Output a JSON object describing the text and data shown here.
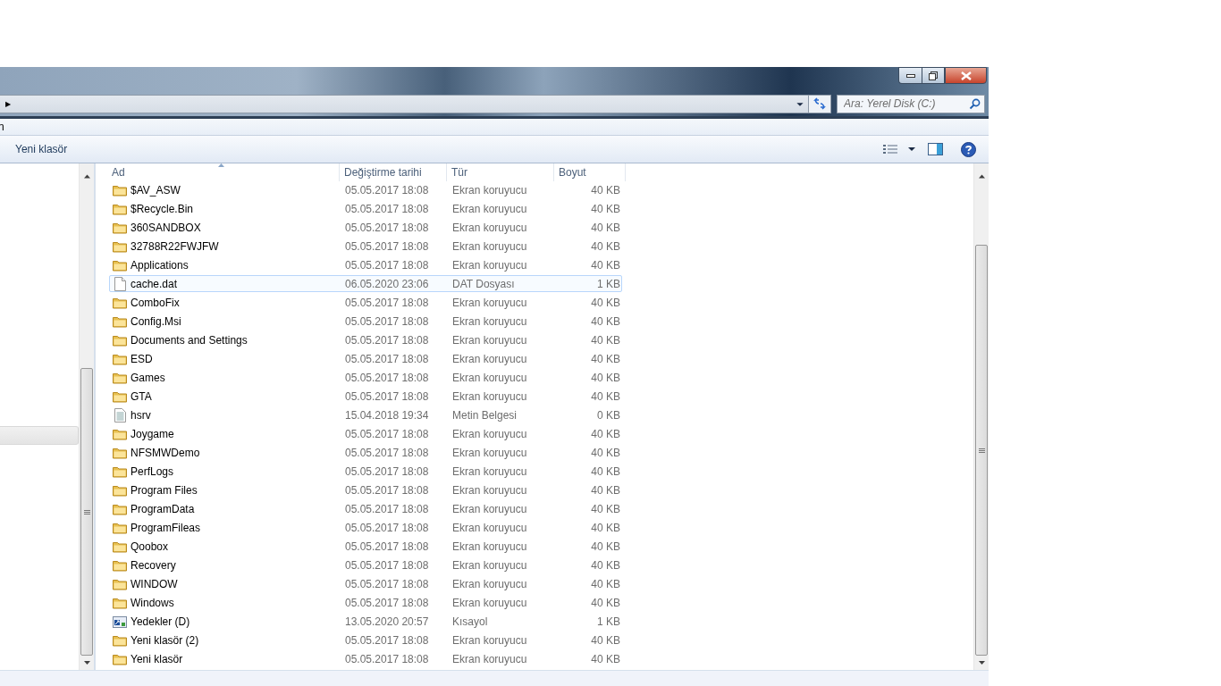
{
  "address_bar": {
    "chevron": "▶"
  },
  "search": {
    "placeholder": "Ara: Yerel Disk (C:)"
  },
  "menu_bar": {
    "items": [
      "n"
    ]
  },
  "toolbar": {
    "items": [
      "Yeni klasör"
    ]
  },
  "table": {
    "columns": [
      {
        "label": "Ad",
        "sorted": true
      },
      {
        "label": "Değiştirme tarihi",
        "sorted": false
      },
      {
        "label": "Tür",
        "sorted": false
      },
      {
        "label": "Boyut",
        "sorted": false
      }
    ],
    "rows": [
      {
        "kind": "folder",
        "name": "$AV_ASW",
        "date": "05.05.2017 18:08",
        "type": "Ekran koruyucu",
        "size": "40 KB",
        "selected": false
      },
      {
        "kind": "folder",
        "name": "$Recycle.Bin",
        "date": "05.05.2017 18:08",
        "type": "Ekran koruyucu",
        "size": "40 KB",
        "selected": false
      },
      {
        "kind": "folder",
        "name": "360SANDBOX",
        "date": "05.05.2017 18:08",
        "type": "Ekran koruyucu",
        "size": "40 KB",
        "selected": false
      },
      {
        "kind": "folder",
        "name": "32788R22FWJFW",
        "date": "05.05.2017 18:08",
        "type": "Ekran koruyucu",
        "size": "40 KB",
        "selected": false
      },
      {
        "kind": "folder",
        "name": "Applications",
        "date": "05.05.2017 18:08",
        "type": "Ekran koruyucu",
        "size": "40 KB",
        "selected": false
      },
      {
        "kind": "file",
        "name": "cache.dat",
        "date": "06.05.2020 23:06",
        "type": "DAT Dosyası",
        "size": "1 KB",
        "selected": true
      },
      {
        "kind": "folder",
        "name": "ComboFix",
        "date": "05.05.2017 18:08",
        "type": "Ekran koruyucu",
        "size": "40 KB",
        "selected": false
      },
      {
        "kind": "folder",
        "name": "Config.Msi",
        "date": "05.05.2017 18:08",
        "type": "Ekran koruyucu",
        "size": "40 KB",
        "selected": false
      },
      {
        "kind": "folder",
        "name": "Documents and Settings",
        "date": "05.05.2017 18:08",
        "type": "Ekran koruyucu",
        "size": "40 KB",
        "selected": false
      },
      {
        "kind": "folder",
        "name": "ESD",
        "date": "05.05.2017 18:08",
        "type": "Ekran koruyucu",
        "size": "40 KB",
        "selected": false
      },
      {
        "kind": "folder",
        "name": "Games",
        "date": "05.05.2017 18:08",
        "type": "Ekran koruyucu",
        "size": "40 KB",
        "selected": false
      },
      {
        "kind": "folder",
        "name": "GTA",
        "date": "05.05.2017 18:08",
        "type": "Ekran koruyucu",
        "size": "40 KB",
        "selected": false
      },
      {
        "kind": "text",
        "name": "hsrv",
        "date": "15.04.2018 19:34",
        "type": "Metin Belgesi",
        "size": "0 KB",
        "selected": false
      },
      {
        "kind": "folder",
        "name": "Joygame",
        "date": "05.05.2017 18:08",
        "type": "Ekran koruyucu",
        "size": "40 KB",
        "selected": false
      },
      {
        "kind": "folder",
        "name": "NFSMWDemo",
        "date": "05.05.2017 18:08",
        "type": "Ekran koruyucu",
        "size": "40 KB",
        "selected": false
      },
      {
        "kind": "folder",
        "name": "PerfLogs",
        "date": "05.05.2017 18:08",
        "type": "Ekran koruyucu",
        "size": "40 KB",
        "selected": false
      },
      {
        "kind": "folder",
        "name": "Program Files",
        "date": "05.05.2017 18:08",
        "type": "Ekran koruyucu",
        "size": "40 KB",
        "selected": false
      },
      {
        "kind": "folder",
        "name": "ProgramData",
        "date": "05.05.2017 18:08",
        "type": "Ekran koruyucu",
        "size": "40 KB",
        "selected": false
      },
      {
        "kind": "folder",
        "name": "ProgramFileas",
        "date": "05.05.2017 18:08",
        "type": "Ekran koruyucu",
        "size": "40 KB",
        "selected": false
      },
      {
        "kind": "folder",
        "name": "Qoobox",
        "date": "05.05.2017 18:08",
        "type": "Ekran koruyucu",
        "size": "40 KB",
        "selected": false
      },
      {
        "kind": "folder",
        "name": "Recovery",
        "date": "05.05.2017 18:08",
        "type": "Ekran koruyucu",
        "size": "40 KB",
        "selected": false
      },
      {
        "kind": "folder",
        "name": "WINDOW",
        "date": "05.05.2017 18:08",
        "type": "Ekran koruyucu",
        "size": "40 KB",
        "selected": false
      },
      {
        "kind": "folder",
        "name": "Windows",
        "date": "05.05.2017 18:08",
        "type": "Ekran koruyucu",
        "size": "40 KB",
        "selected": false
      },
      {
        "kind": "shortcut",
        "name": "Yedekler (D)",
        "date": "13.05.2020 20:57",
        "type": "Kısayol",
        "size": "1 KB",
        "selected": false
      },
      {
        "kind": "folder",
        "name": "Yeni klasör (2)",
        "date": "05.05.2017 18:08",
        "type": "Ekran koruyucu",
        "size": "40 KB",
        "selected": false
      },
      {
        "kind": "folder",
        "name": "Yeni klasör",
        "date": "05.05.2017 18:08",
        "type": "Ekran koruyucu",
        "size": "40 KB",
        "selected": false
      }
    ]
  }
}
